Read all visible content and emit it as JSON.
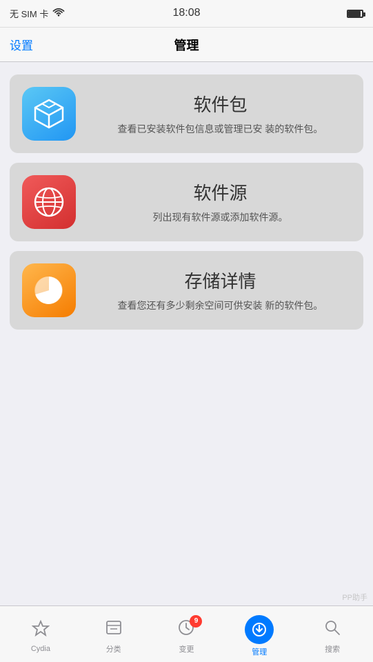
{
  "statusBar": {
    "carrier": "无 SIM 卡",
    "time": "18:08",
    "wifiSymbol": "📶"
  },
  "navBar": {
    "backLabel": "设置",
    "title": "管理"
  },
  "cards": [
    {
      "id": "packages",
      "title": "软件包",
      "desc": "查看已安装软件包信息或管理已安\n装的软件包。",
      "iconType": "packages"
    },
    {
      "id": "sources",
      "title": "软件源",
      "desc": "列出现有软件源或添加软件源。",
      "iconType": "sources"
    },
    {
      "id": "storage",
      "title": "存储详情",
      "desc": "查看您还有多少剩余空间可供安装\n新的软件包。",
      "iconType": "storage"
    }
  ],
  "tabBar": {
    "items": [
      {
        "id": "cydia",
        "label": "Cydia",
        "icon": "star"
      },
      {
        "id": "categories",
        "label": "分类",
        "icon": "list"
      },
      {
        "id": "changes",
        "label": "变更",
        "icon": "clock",
        "badge": "9"
      },
      {
        "id": "manage",
        "label": "管理",
        "icon": "arrow-down",
        "active": true
      },
      {
        "id": "search",
        "label": "搜索",
        "icon": "search"
      }
    ]
  },
  "watermark": "PP助手"
}
